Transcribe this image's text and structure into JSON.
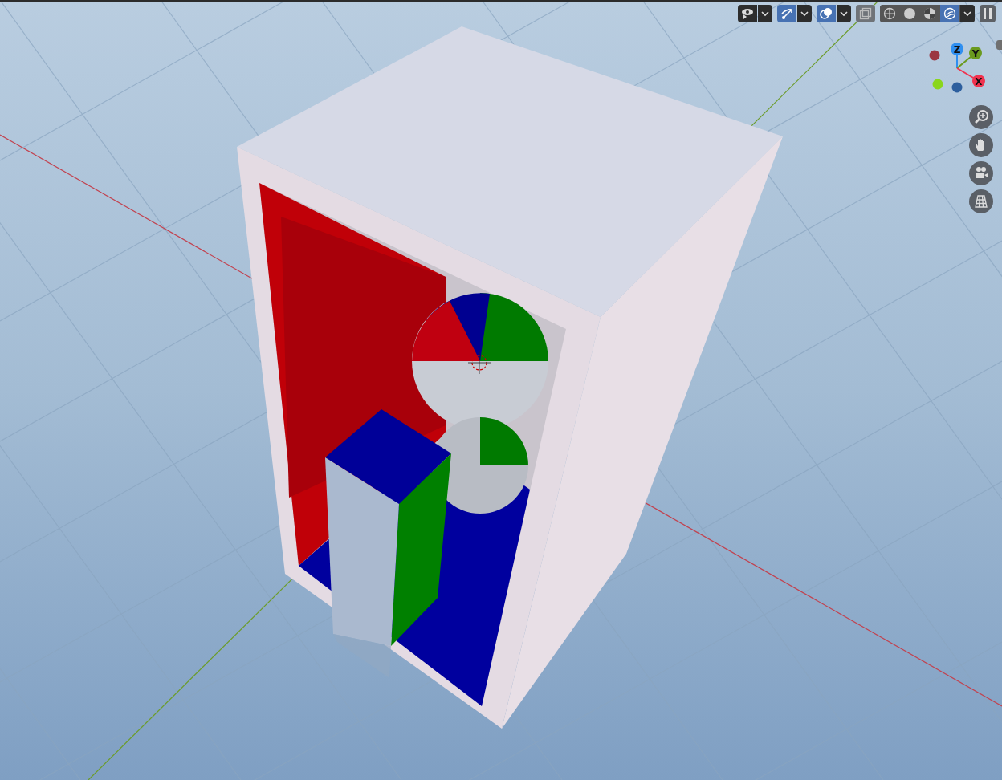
{
  "viewport": {
    "header_buttons": [
      {
        "kind": "visibility",
        "selected": false
      },
      {
        "kind": "gizmo",
        "selected": true
      },
      {
        "kind": "overlay",
        "selected": true
      },
      {
        "kind": "xray",
        "selected": false
      }
    ],
    "shading_modes": [
      {
        "kind": "wireframe",
        "selected": false
      },
      {
        "kind": "solid",
        "selected": false
      },
      {
        "kind": "material",
        "selected": false
      },
      {
        "kind": "rendered",
        "selected": true
      }
    ],
    "axes": [
      {
        "label": "Z",
        "color": "#2f8ff0"
      },
      {
        "label": "Y",
        "color": "#6a9a1e"
      },
      {
        "label": "X",
        "color": "#f0334f"
      }
    ],
    "nav_tools": [
      {
        "kind": "zoom"
      },
      {
        "kind": "pan"
      },
      {
        "kind": "camera"
      },
      {
        "kind": "ortho"
      }
    ]
  }
}
